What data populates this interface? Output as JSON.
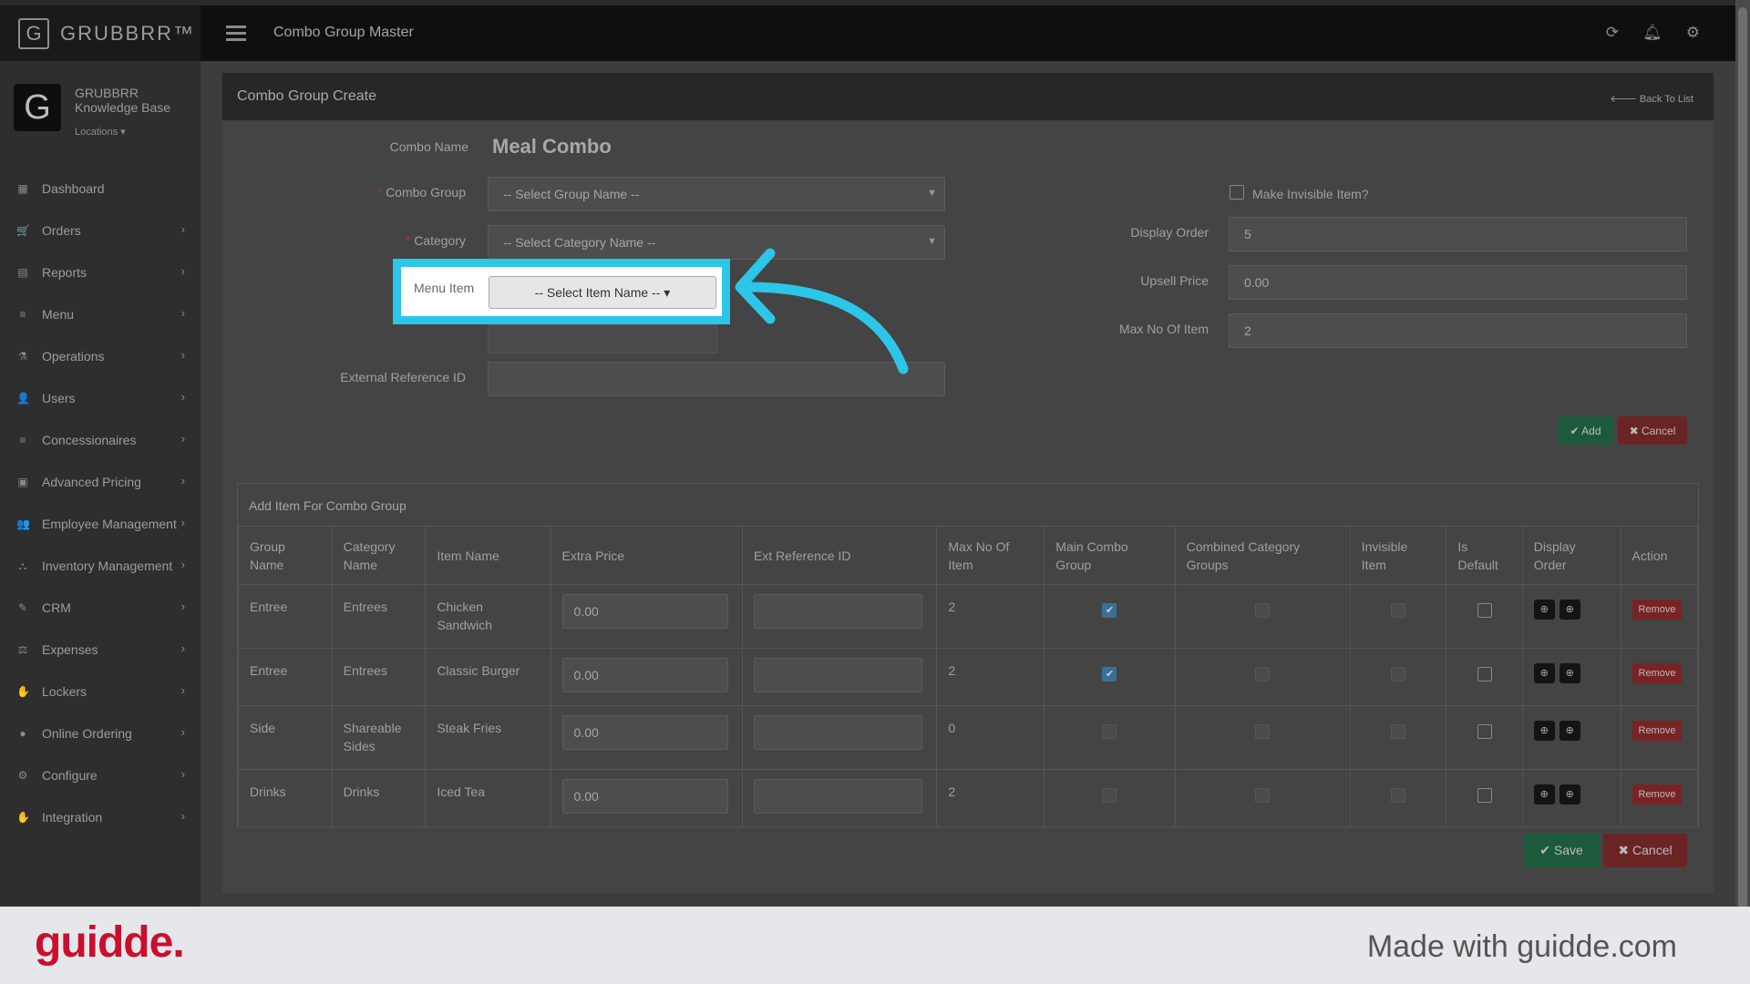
{
  "app": {
    "brand": "GRUBBRR™",
    "page_title": "Combo Group Master"
  },
  "profile": {
    "name": "GRUBBRR Knowledge Base",
    "locations": "Locations ▾"
  },
  "topbar_icons": [
    "refresh-icon",
    "bell-icon",
    "gear-icon"
  ],
  "sidebar": {
    "items": [
      {
        "label": "Dashboard",
        "icon": "▦",
        "chevron": false
      },
      {
        "label": "Orders",
        "icon": "🛒",
        "chevron": true
      },
      {
        "label": "Reports",
        "icon": "▤",
        "chevron": true
      },
      {
        "label": "Menu",
        "icon": "≡",
        "chevron": true
      },
      {
        "label": "Operations",
        "icon": "⚗",
        "chevron": true
      },
      {
        "label": "Users",
        "icon": "👤",
        "chevron": true
      },
      {
        "label": "Concessionaires",
        "icon": "≡",
        "chevron": true
      },
      {
        "label": "Advanced Pricing",
        "icon": "▣",
        "chevron": true
      },
      {
        "label": "Employee Management",
        "icon": "👥",
        "chevron": true
      },
      {
        "label": "Inventory Management",
        "icon": "⛬",
        "chevron": true
      },
      {
        "label": "CRM",
        "icon": "✎",
        "chevron": true
      },
      {
        "label": "Expenses",
        "icon": "⚖",
        "chevron": true
      },
      {
        "label": "Lockers",
        "icon": "✋",
        "chevron": true
      },
      {
        "label": "Online Ordering",
        "icon": "●",
        "chevron": true
      },
      {
        "label": "Configure",
        "icon": "⚙",
        "chevron": true
      },
      {
        "label": "Integration",
        "icon": "✋",
        "chevron": true
      }
    ]
  },
  "card": {
    "title": "Combo Group Create",
    "back_link": "🡐 Back To List"
  },
  "form": {
    "combo_name_label": "Combo Name",
    "combo_name_value": "Meal Combo",
    "combo_group_label": "Combo Group",
    "combo_group_value": "-- Select Group Name --",
    "category_label": "Category",
    "category_value": "-- Select Category Name --",
    "menu_item_label": "Menu Item",
    "menu_item_value": "-- Select Item Name -- ▾",
    "external_ref_label": "External Reference ID",
    "external_ref_value": "",
    "make_invisible_label": "Make Invisible Item?",
    "display_order_label": "Display Order",
    "display_order_value": "5",
    "upsell_price_label": "Upsell Price",
    "upsell_price_value": "0.00",
    "max_items_label": "Max No Of Item",
    "max_items_value": "2",
    "add_button": "✔ Add",
    "cancel_button": "✖ Cancel"
  },
  "table": {
    "caption": "Add Item For Combo Group",
    "headers": [
      "Group Name",
      "Category Name",
      "Item Name",
      "Extra Price",
      "Ext Reference ID",
      "Max No Of Item",
      "Main Combo Group",
      "Combined Category Groups",
      "Invisible Item",
      "Is Default",
      "Display Order",
      "Action"
    ],
    "rows": [
      {
        "group": "Entree",
        "category": "Entrees",
        "item": "Chicken Sandwich",
        "extra_price": "0.00",
        "ext_ref": "",
        "max_items": "2",
        "main_combo": true,
        "remove": "Remove"
      },
      {
        "group": "Entree",
        "category": "Entrees",
        "item": "Classic Burger",
        "extra_price": "0.00",
        "ext_ref": "",
        "max_items": "2",
        "main_combo": true,
        "remove": "Remove"
      },
      {
        "group": "Side",
        "category": "Shareable Sides",
        "item": "Steak Fries",
        "extra_price": "0.00",
        "ext_ref": "",
        "max_items": "0",
        "main_combo": false,
        "remove": "Remove"
      },
      {
        "group": "Drinks",
        "category": "Drinks",
        "item": "Iced Tea",
        "extra_price": "0.00",
        "ext_ref": "",
        "max_items": "2",
        "main_combo": false,
        "remove": "Remove"
      }
    ],
    "save_button": "✔ Save",
    "cancel_button": "✖ Cancel"
  },
  "footer": {
    "logo": "guidde.",
    "made_with": "Made with guidde.com"
  },
  "colors": {
    "highlight": "#2cc6e8",
    "guidde_red": "#c8102e"
  }
}
